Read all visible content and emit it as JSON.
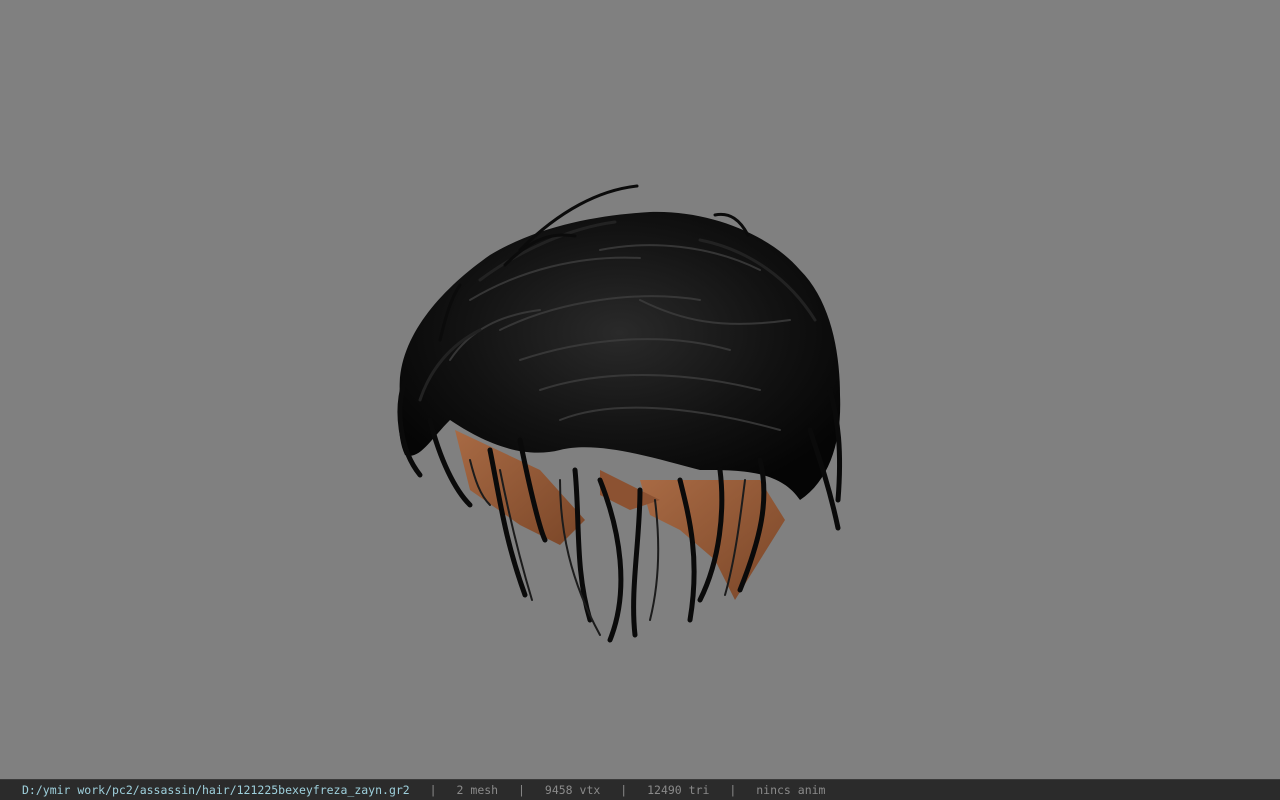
{
  "viewport": {
    "background": "#808080",
    "model": {
      "kind": "hair-mesh-render",
      "hair_color": "#0e0e0e",
      "skin_color": "#9a5e3a"
    }
  },
  "status": {
    "path": "D:/ymir work/pc2/assassin/hair/121225bexeyfreza_zayn.gr2",
    "separator": "|",
    "mesh": "2 mesh",
    "vtx": "9458 vtx",
    "tri": "12490 tri",
    "anim": "nincs anim"
  }
}
